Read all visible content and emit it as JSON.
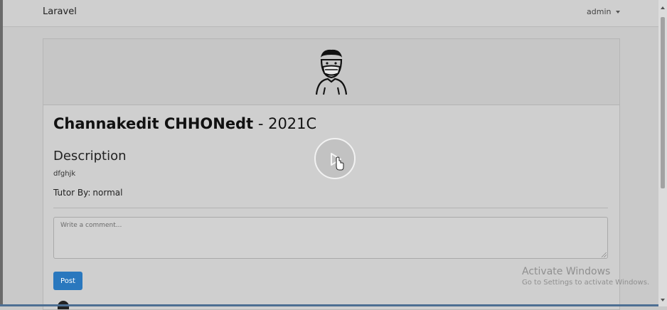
{
  "navbar": {
    "brand": "Laravel",
    "user": "admin"
  },
  "course": {
    "name": "Channakedit CHHONedt",
    "separator": " - ",
    "code": "2021C",
    "description_heading": "Description",
    "description_text": "dfghjk",
    "tutor_label": "Tutor By:",
    "tutor_name": "normal"
  },
  "comment": {
    "placeholder": "Write a comment...",
    "post_label": "Post"
  },
  "watermark": {
    "title": "Activate Windows",
    "subtitle": "Go to Settings to activate Windows."
  },
  "icons": {
    "avatar": "masked-person-avatar-icon",
    "play": "play-icon",
    "cursor": "hand-pointer-icon",
    "caret": "caret-down-icon"
  },
  "colors": {
    "primary_button": "#2a78be",
    "navbar": "#cfcfcf",
    "overlay": "#c9c9c9"
  }
}
